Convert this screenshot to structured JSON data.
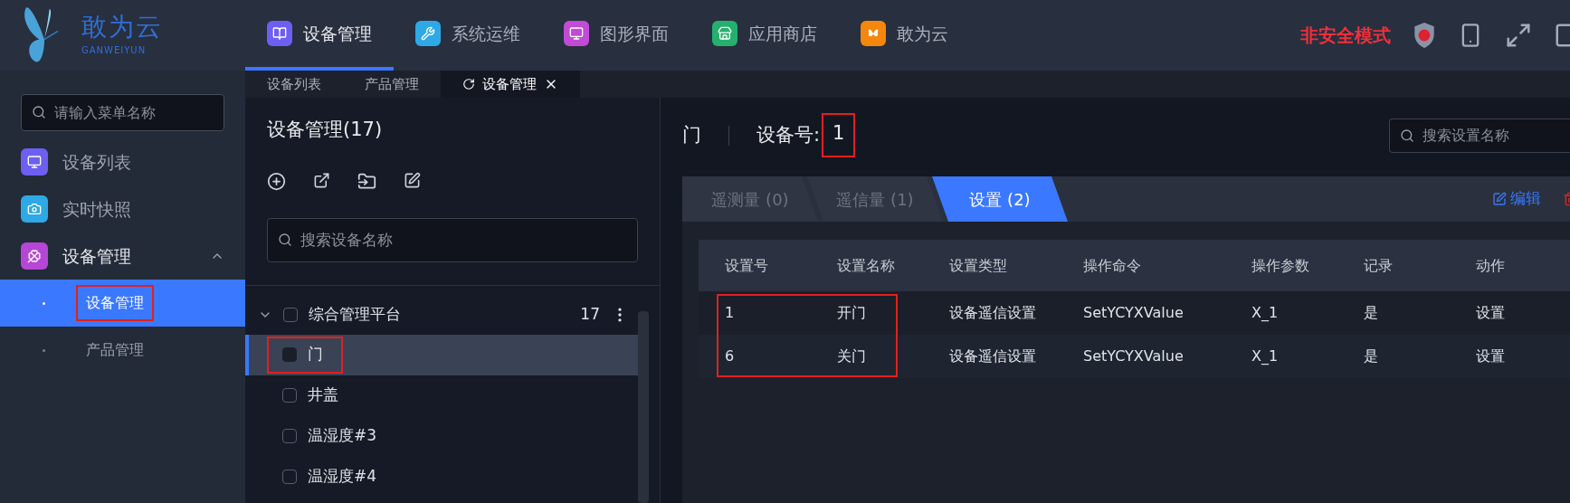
{
  "logo": {
    "title": "敢为云",
    "subtitle": "GANWEIYUN"
  },
  "top_nav": [
    {
      "label": "设备管理",
      "kind": "book",
      "color": "#6d5ff2",
      "selected": true
    },
    {
      "label": "系统运维",
      "kind": "wrench",
      "color": "#2fa8e6",
      "selected": false
    },
    {
      "label": "图形界面",
      "kind": "screen",
      "color": "#c04bd6",
      "selected": false
    },
    {
      "label": "应用商店",
      "kind": "store",
      "color": "#25b06e",
      "selected": false
    },
    {
      "label": "敢为云",
      "kind": "butterfly",
      "color": "#f5880c",
      "selected": false
    }
  ],
  "mode_label": "非安全模式",
  "page_tabs": [
    {
      "label": "设备列表",
      "selected": false
    },
    {
      "label": "产品管理",
      "selected": false
    },
    {
      "label": "设备管理",
      "selected": true
    }
  ],
  "sidebar": {
    "search_placeholder": "请输入菜单名称",
    "items": [
      {
        "label": "设备列表",
        "kind": "monitor",
        "color": "#6d5ff2"
      },
      {
        "label": "实时快照",
        "kind": "camera",
        "color": "#2fa8e6"
      },
      {
        "label": "设备管理",
        "kind": "grid",
        "color": "#b646d6",
        "expanded": true,
        "children": [
          {
            "label": "设备管理",
            "selected": true,
            "highlighted": true
          },
          {
            "label": "产品管理",
            "selected": false,
            "highlighted": false
          }
        ]
      }
    ]
  },
  "tree": {
    "title": "设备管理(17)",
    "search_placeholder": "搜索设备名称",
    "root": {
      "label": "综合管理平台",
      "count": "17",
      "expanded": true,
      "checked": false,
      "children": [
        {
          "label": "门",
          "selected": true,
          "checked": false,
          "highlighted": true
        },
        {
          "label": "井盖",
          "selected": false,
          "checked": false,
          "highlighted": false
        },
        {
          "label": "温湿度#3",
          "selected": false,
          "checked": false,
          "highlighted": false
        },
        {
          "label": "温湿度#4",
          "selected": false,
          "checked": false,
          "highlighted": false
        }
      ]
    }
  },
  "detail": {
    "device_name": "门",
    "device_no_label": "设备号:",
    "device_no": "1",
    "device_no_highlighted": true,
    "search_placeholder": "搜索设置名称",
    "tabs": [
      {
        "label": "遥测量 (0)",
        "selected": false
      },
      {
        "label": "遥信量 (1)",
        "selected": false
      },
      {
        "label": "设置 (2)",
        "selected": true
      }
    ],
    "edit_label": "编辑",
    "table": {
      "columns": [
        "设置号",
        "设置名称",
        "设置类型",
        "操作命令",
        "操作参数",
        "记录",
        "动作"
      ],
      "rows_highlighted": true,
      "rows": [
        [
          "1",
          "开门",
          "设备遥信设置",
          "SetYCYXValue",
          "X_1",
          "是",
          "设置"
        ],
        [
          "6",
          "关门",
          "设备遥信设置",
          "SetYCYXValue",
          "X_1",
          "是",
          "设置"
        ]
      ]
    }
  }
}
